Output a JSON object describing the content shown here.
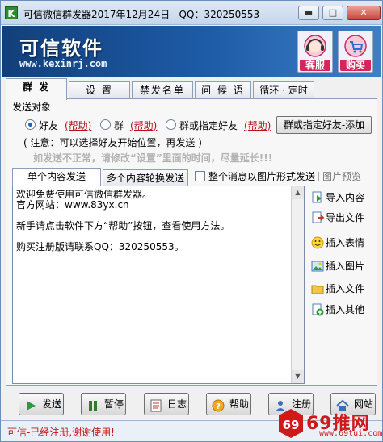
{
  "window": {
    "icon_letter": "K",
    "title": "可信微信群发器2017年12月24日",
    "qq": "QQ：320250553",
    "min_label": "▬",
    "max_label": "□",
    "close_label": "✕"
  },
  "banner": {
    "brand": "可信软件",
    "url": "www.kexinrj.com",
    "service_label": "客服",
    "buy_label": "购买"
  },
  "tabs": [
    {
      "label": "群 发",
      "active": true
    },
    {
      "label": "设 置",
      "active": false
    },
    {
      "label": "禁发名单",
      "active": false
    },
    {
      "label": "问 候 语",
      "active": false
    },
    {
      "label": "循环 · 定时",
      "active": false
    }
  ],
  "send_target": {
    "section_label": "发送对象",
    "options": [
      {
        "label": "好友",
        "help": "(帮助)",
        "selected": true
      },
      {
        "label": "群",
        "help": "(帮助)",
        "selected": false
      },
      {
        "label": "群或指定好友",
        "help": "(帮助)",
        "selected": false
      }
    ],
    "add_button": "群或指定好友-添加",
    "note": "( 注意：可以选择好友开始位置，再发送 )",
    "tip": "如发送不正常，请修改“设置”里面的时间，尽量延长!!!"
  },
  "content_tabs": [
    {
      "label": "单个内容发送",
      "active": true
    },
    {
      "label": "多个内容轮换发送",
      "active": false
    }
  ],
  "image_mode_checkbox": {
    "label": "整个消息以图片形式发送",
    "checked": false
  },
  "preview_label": "图片预览",
  "editor": {
    "text": "欢迎免费使用可信微信群发器。\n官方网站：www.83yx.cn\n\n新手请点击软件下方“帮助”按钮，查看使用方法。\n\n购买注册版请联系QQ：320250553。"
  },
  "side_buttons": [
    {
      "label": "导入内容",
      "icon": "import-icon"
    },
    {
      "label": "导出文件",
      "icon": "export-icon"
    },
    {
      "label": "插入表情",
      "icon": "smiley-icon"
    },
    {
      "label": "插入图片",
      "icon": "image-icon"
    },
    {
      "label": "插入文件",
      "icon": "folder-icon"
    },
    {
      "label": "插入其他",
      "icon": "plus-icon"
    }
  ],
  "bottom_buttons": [
    {
      "label": "发送",
      "icon": "play-icon"
    },
    {
      "label": "暂停",
      "icon": "pause-icon"
    },
    {
      "label": "日志",
      "icon": "log-icon"
    },
    {
      "label": "帮助",
      "icon": "help-icon"
    },
    {
      "label": "注册",
      "icon": "user-icon"
    },
    {
      "label": "网站",
      "icon": "home-icon"
    }
  ],
  "status": {
    "text": "可信-已经注册,谢谢使用!"
  },
  "watermark": {
    "big": "69推网",
    "small": "www.69tui.com"
  },
  "colors": {
    "banner": "#1e5ca8",
    "link": "#b5121b",
    "status": "#c4161c"
  }
}
